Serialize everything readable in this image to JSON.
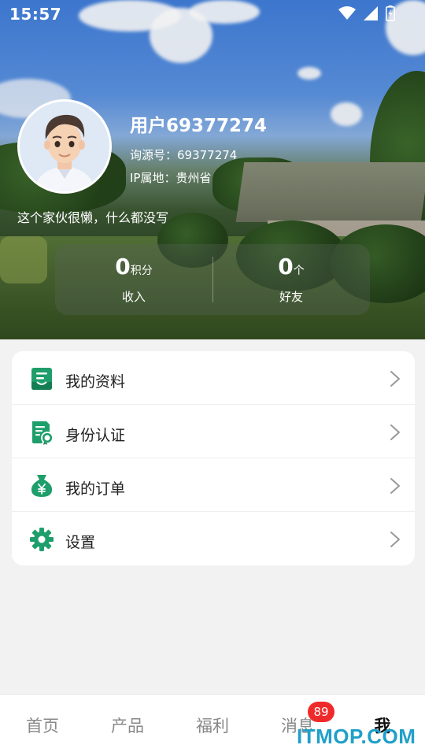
{
  "status_bar": {
    "time": "15:57"
  },
  "profile": {
    "username": "用户69377274",
    "source_line": "询源号：69377274",
    "ip_line": "IP属地：贵州省",
    "bio": "这个家伙很懒，什么都没写"
  },
  "stats": [
    {
      "value": "0",
      "unit": "积分",
      "label": "收入"
    },
    {
      "value": "0",
      "unit": "个",
      "label": "好友"
    }
  ],
  "menu": [
    {
      "label": "我的资料",
      "icon": "profile-doc-icon"
    },
    {
      "label": "身份认证",
      "icon": "certificate-icon"
    },
    {
      "label": "我的订单",
      "icon": "money-bag-icon"
    },
    {
      "label": "设置",
      "icon": "gear-icon"
    }
  ],
  "nav": [
    {
      "label": "首页"
    },
    {
      "label": "产品"
    },
    {
      "label": "福利"
    },
    {
      "label": "消息"
    },
    {
      "label": "我"
    }
  ],
  "badge": {
    "count": "89"
  },
  "watermark": "ITMOP.COM",
  "colors": {
    "accent": "#1e9e6a",
    "badge": "#f02a2a",
    "nav_inactive": "#888888"
  }
}
